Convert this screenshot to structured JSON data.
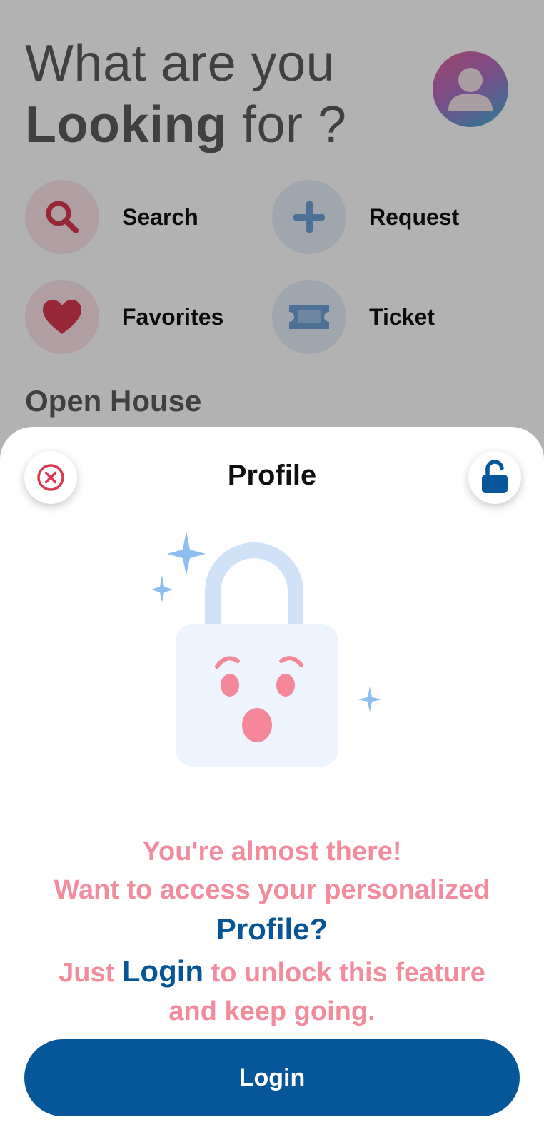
{
  "home": {
    "headline_line1": "What are you",
    "headline_bold": "Looking",
    "headline_rest": " for ?",
    "actions": [
      {
        "label": "Search",
        "icon": "search-icon"
      },
      {
        "label": "Request",
        "icon": "plus-icon"
      },
      {
        "label": "Favorites",
        "icon": "heart-icon"
      },
      {
        "label": "Ticket",
        "icon": "ticket-icon"
      }
    ],
    "section_title": "Open House"
  },
  "sheet": {
    "title": "Profile",
    "close_icon": "close-icon",
    "lock_icon": "unlock-icon",
    "message_line1": "You're almost there!",
    "message_line2": "Want to access your personalized",
    "message_line3": "Profile?",
    "message_line4_pre": "Just ",
    "message_line4_accent": "Login",
    "message_line4_post": " to unlock this feature",
    "message_line5": "and keep going.",
    "login_label": "Login"
  },
  "colors": {
    "primary": "#065799",
    "pink_text": "#f28b9c",
    "danger": "#d9394f"
  }
}
